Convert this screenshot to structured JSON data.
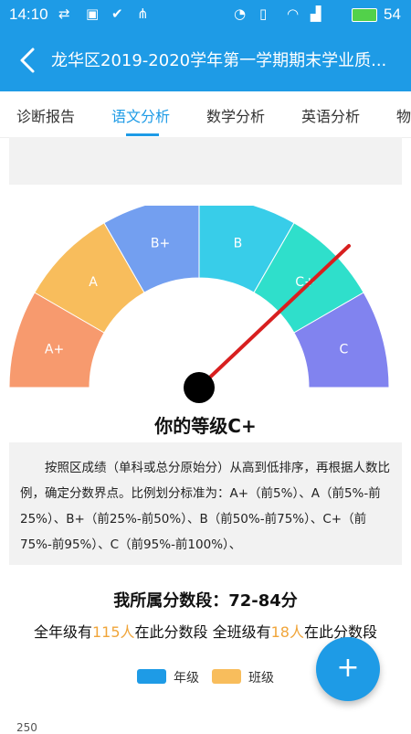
{
  "status_bar": {
    "time": "14:10",
    "battery": "54"
  },
  "app_bar": {
    "title": "龙华区2019-2020学年第一学期期末学业质..."
  },
  "tabs": [
    {
      "label": "诊断报告"
    },
    {
      "label": "语文分析"
    },
    {
      "label": "数学分析"
    },
    {
      "label": "英语分析"
    },
    {
      "label": "物"
    }
  ],
  "gauge": {
    "segments": [
      {
        "label": "A+",
        "color": "#f79a6e"
      },
      {
        "label": "A",
        "color": "#f8bd5c"
      },
      {
        "label": "B+",
        "color": "#739ff0"
      },
      {
        "label": "B",
        "color": "#38cde9"
      },
      {
        "label": "C+",
        "color": "#2fdfcb"
      },
      {
        "label": "C",
        "color": "#8183ef"
      }
    ],
    "needle_color": "#d81f1f"
  },
  "grade": {
    "title": "你的等级C+"
  },
  "description": {
    "text": "按照区成绩（单科或总分原始分）从高到低排序，再根据人数比例，确定分数界点。比例划分标准为：A+（前5%）、A（前5%-前25%）、B+（前25%-前50%）、B（前50%-前75%）、C+（前75%-前95%）、C（前95%-前100%）、"
  },
  "segment_info": {
    "title": "我所属分数段：72-84分",
    "grade_prefix": "全年级有",
    "grade_count": "115人",
    "grade_suffix": "在此分数段 全班级有",
    "class_count": "18人",
    "class_suffix": "在此分数段"
  },
  "legend": [
    {
      "label": "年级",
      "color": "#1e9be6"
    },
    {
      "label": "班级",
      "color": "#f8bd5c"
    }
  ],
  "axis": {
    "first_tick": "250"
  },
  "fab": {
    "label": "+"
  },
  "colors": {
    "primary": "#1e9be6",
    "highlight": "#f0a53a"
  }
}
